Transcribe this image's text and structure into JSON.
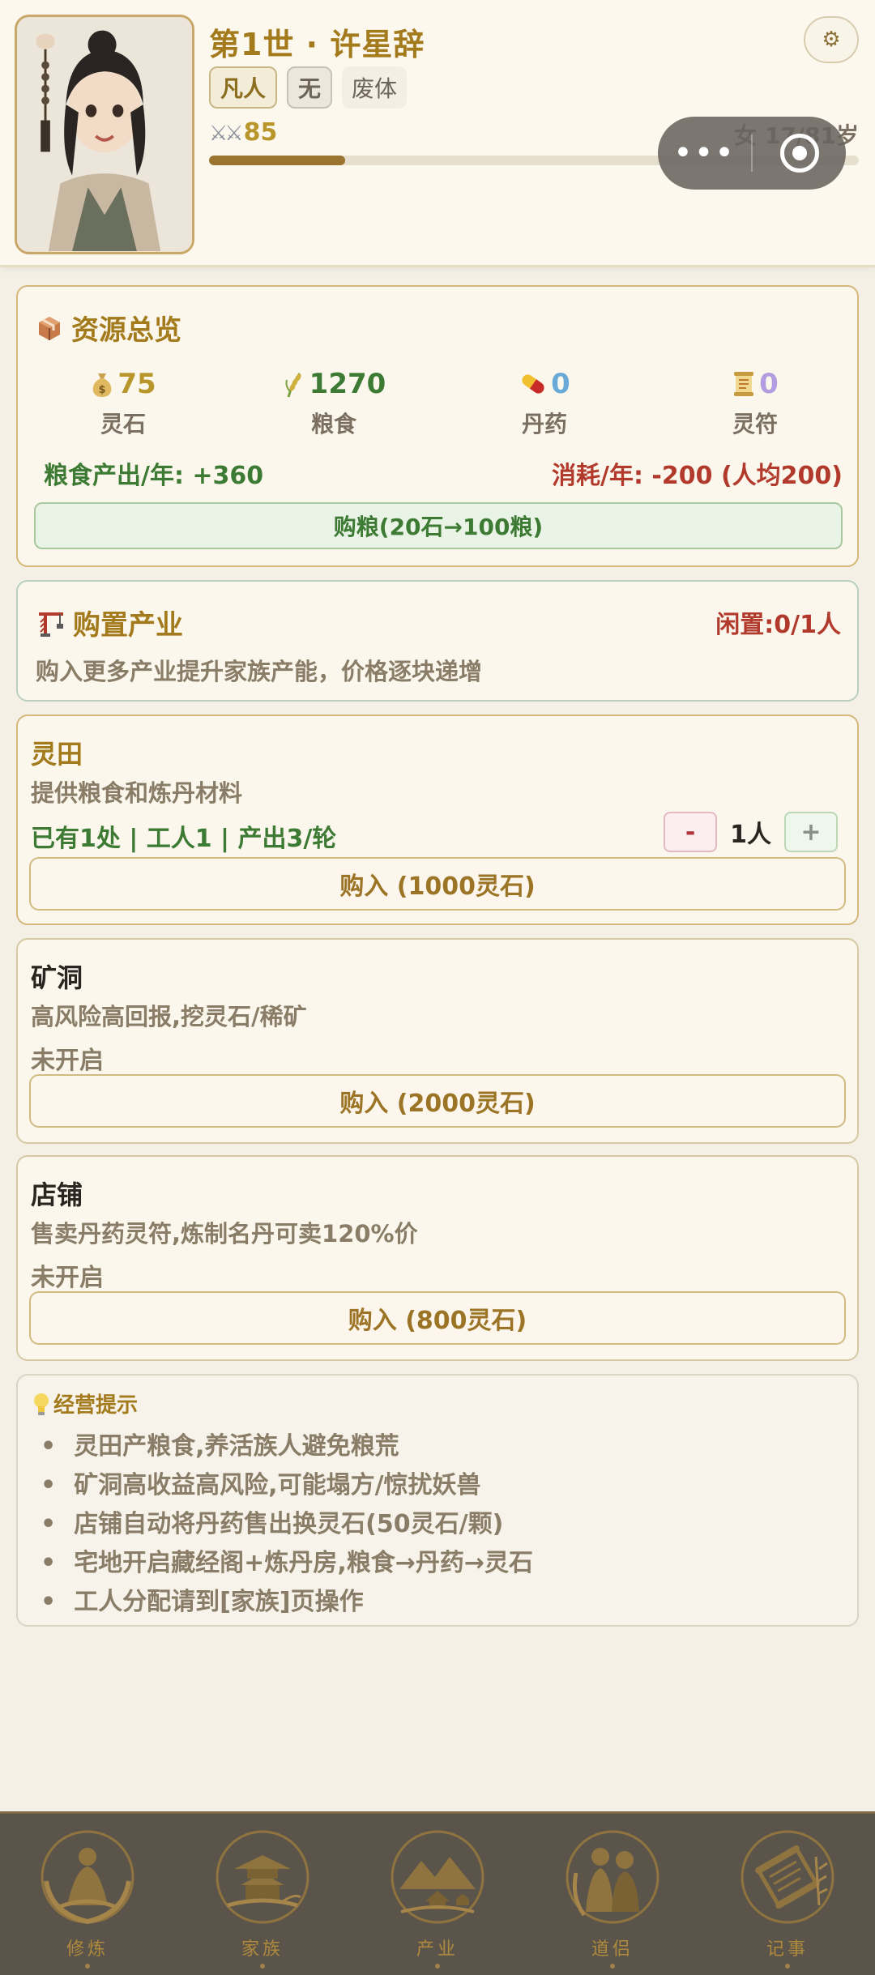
{
  "header": {
    "title": "第1世 · 许星辞",
    "realm": "凡人",
    "root": "无",
    "body": "废体",
    "power_prefix": "⚔⚔",
    "power": "85",
    "age": "女 17/81岁",
    "age_progress": 0.21,
    "settings_icon": "gear-icon"
  },
  "resources": {
    "title": "资源总览",
    "items": [
      {
        "icon": "money-bag-icon",
        "value": "75",
        "label": "灵石",
        "color": "#b8962c"
      },
      {
        "icon": "rice-icon",
        "value": "1270",
        "label": "粮食",
        "color": "#3d7a34"
      },
      {
        "icon": "pill-icon",
        "value": "0",
        "label": "丹药",
        "color": "#6aaad8"
      },
      {
        "icon": "scroll-icon",
        "value": "0",
        "label": "灵符",
        "color": "#b49ce0"
      }
    ],
    "grain_output": "粮食产出/年: +360",
    "consumption": "消耗/年: -200 (人均200)",
    "buy_grain_label": "购粮(20石→100粮)"
  },
  "industry": {
    "title": "购置产业",
    "idle": "闲置:0/1人",
    "desc": "购入更多产业提升家族产能，价格逐块递增"
  },
  "properties": [
    {
      "name": "灵田",
      "desc": "提供粮食和炼丹材料",
      "status": "已有1处 | 工人1 | 产出3/轮",
      "stepper_minus": "-",
      "stepper_value": "1人",
      "stepper_plus": "+",
      "button": "购入 (1000灵石)"
    },
    {
      "name": "矿洞",
      "desc": "高风险高回报,挖灵石/稀矿",
      "status": "未开启",
      "button": "购入 (2000灵石)"
    },
    {
      "name": "店铺",
      "desc": "售卖丹药灵符,炼制名丹可卖120%价",
      "status": "未开启",
      "button": "购入 (800灵石)"
    }
  ],
  "tips": {
    "title": "经营提示",
    "items": [
      "灵田产粮食,养活族人避免粮荒",
      "矿洞高收益高风险,可能塌方/惊扰妖兽",
      "店铺自动将丹药售出换灵石(50灵石/颗)",
      "宅地开启藏经阁+炼丹房,粮食→丹药→灵石",
      "工人分配请到[家族]页操作"
    ]
  },
  "nav": {
    "items": [
      {
        "label": "修炼",
        "icon": "meditation-icon"
      },
      {
        "label": "家族",
        "icon": "pavilion-icon"
      },
      {
        "label": "产业",
        "icon": "landscape-icon"
      },
      {
        "label": "道侣",
        "icon": "couple-icon"
      },
      {
        "label": "记事",
        "icon": "scroll-icon"
      }
    ]
  },
  "capsule": {
    "more": "•••"
  }
}
